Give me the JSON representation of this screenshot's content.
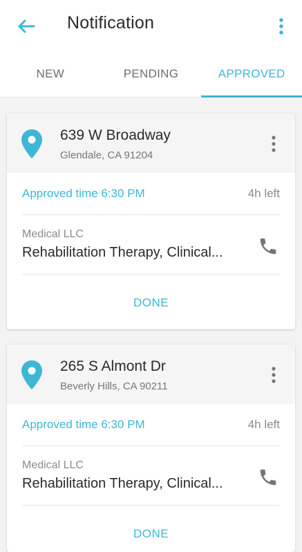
{
  "header": {
    "title": "Notification",
    "back_icon": "arrow-left-icon",
    "menu_icon": "more-vertical-icon"
  },
  "tabs": [
    {
      "label": "NEW",
      "active": false
    },
    {
      "label": "PENDING",
      "active": false
    },
    {
      "label": "APPROVED",
      "active": true
    }
  ],
  "colors": {
    "accent": "#3db7d3",
    "text_primary": "#2a2a2a",
    "text_secondary": "#8a8a8a",
    "background": "#f3f3f3"
  },
  "cards": [
    {
      "street": "639 W Broadway",
      "city": "Glendale, CA 91204",
      "approved_time": "Approved time 6:30 PM",
      "time_left": "4h left",
      "company": "Medical LLC",
      "service": "Rehabilitation Therapy, Clinical...",
      "action": "DONE"
    },
    {
      "street": "265 S Almont Dr",
      "city": "Beverly Hills, CA 90211",
      "approved_time": "Approved time 6:30 PM",
      "time_left": "4h left",
      "company": "Medical LLC",
      "service": "Rehabilitation Therapy, Clinical...",
      "action": "DONE"
    }
  ]
}
